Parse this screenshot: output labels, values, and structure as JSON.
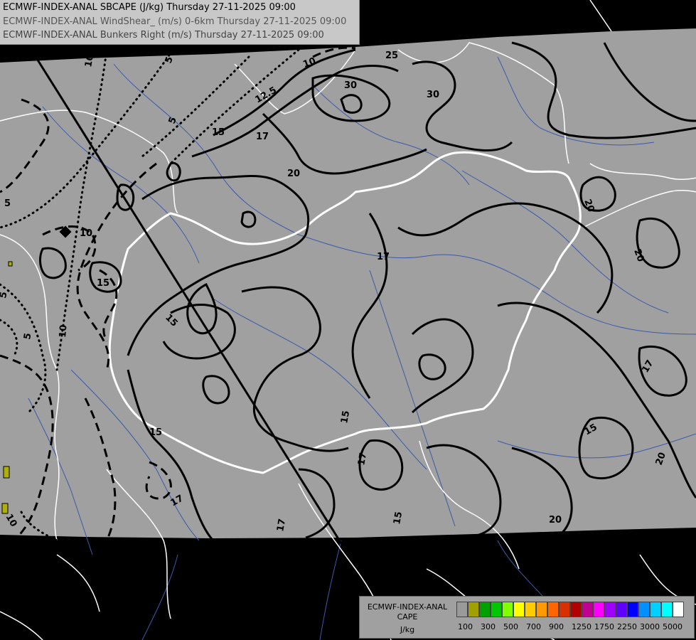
{
  "header": {
    "line1": "ECMWF-INDEX-ANAL SBCAPE (J/kg) Thursday 27-11-2025 09:00",
    "line2": "ECMWF-INDEX-ANAL WindShear_ (m/s) 0-6km Thursday 27-11-2025 09:00",
    "line3": "ECMWF-INDEX-ANAL Bunkers Right (m/s) Thursday 27-11-2025 09:00"
  },
  "contour_labels": {
    "shear_10": "10",
    "shear_12_5": "12.5",
    "shear_15": "15",
    "shear_17": "17",
    "shear_20": "20",
    "shear_25": "25",
    "shear_30": "30",
    "bunkers_5": "5",
    "bunkers_10": "10"
  },
  "legend": {
    "line1": "ECMWF-INDEX-ANAL",
    "line2": "CAPE",
    "line3": "J/kg",
    "colors": [
      "#9a9a9a",
      "#a0a000",
      "#00a000",
      "#00c800",
      "#80ff00",
      "#ffff00",
      "#ffcc00",
      "#ff9900",
      "#ff6600",
      "#d83000",
      "#b00000",
      "#c00090",
      "#ff00ff",
      "#a000ff",
      "#6000ff",
      "#0000ff",
      "#0090ff",
      "#00d0ff",
      "#00ffff",
      "#ffffff"
    ],
    "ticks": [
      "100",
      "300",
      "500",
      "700",
      "900",
      "1250",
      "1750",
      "2250",
      "3000",
      "5000"
    ]
  }
}
